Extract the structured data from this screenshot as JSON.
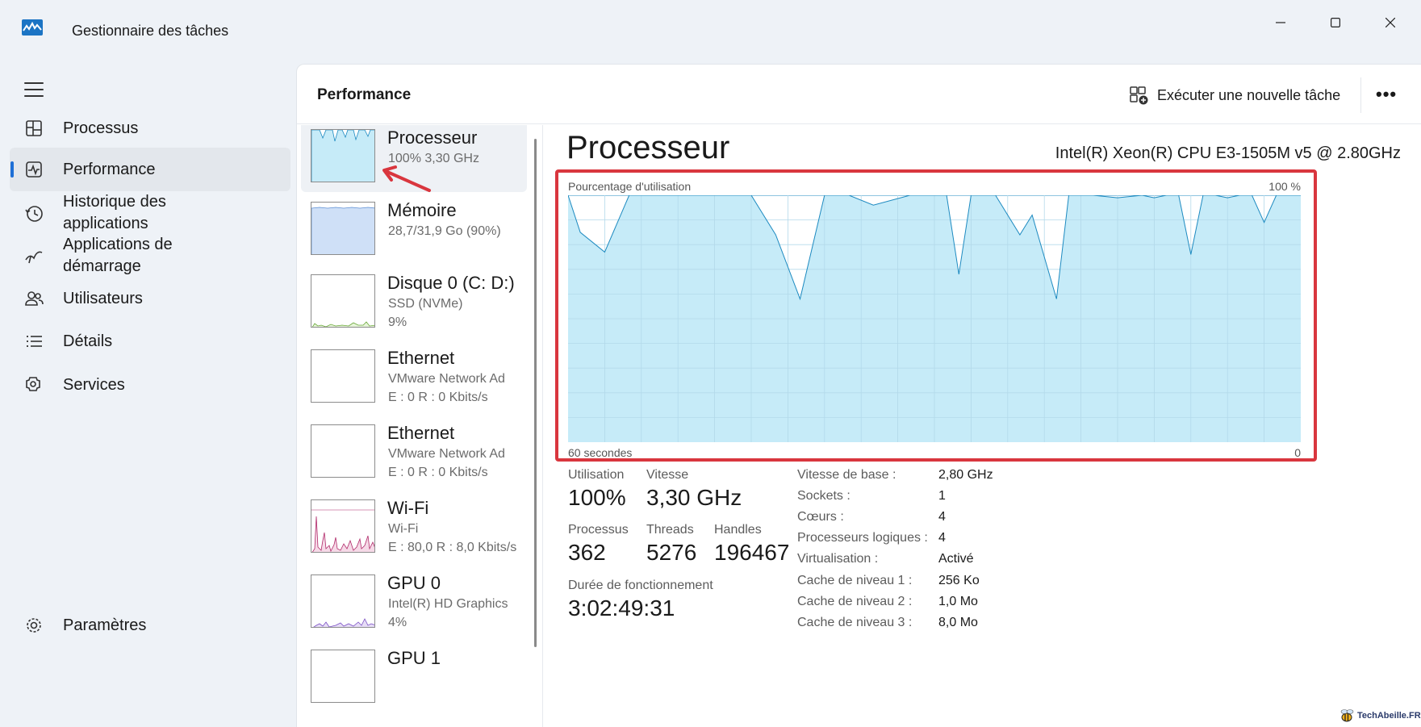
{
  "window": {
    "title": "Gestionnaire des tâches",
    "controls": [
      "minimize",
      "maximize",
      "close"
    ]
  },
  "nav": {
    "items": [
      {
        "label": "Processus",
        "icon": "processes-icon",
        "active": false
      },
      {
        "label": "Performance",
        "icon": "performance-icon",
        "active": true
      },
      {
        "label": "Historique des applications",
        "icon": "history-icon",
        "active": false
      },
      {
        "label": "Applications de démarrage",
        "icon": "startup-icon",
        "active": false
      },
      {
        "label": "Utilisateurs",
        "icon": "users-icon",
        "active": false
      },
      {
        "label": "Détails",
        "icon": "details-icon",
        "active": false
      },
      {
        "label": "Services",
        "icon": "services-icon",
        "active": false
      }
    ],
    "settings_label": "Paramètres"
  },
  "header": {
    "title": "Performance",
    "run_task_label": "Exécuter une nouvelle tâche",
    "more_label": "•••"
  },
  "resources": [
    {
      "name": "Processeur",
      "line1": "100%  3,30 GHz",
      "line2": "",
      "active": true
    },
    {
      "name": "Mémoire",
      "line1": "28,7/31,9 Go (90%)",
      "line2": "",
      "active": false
    },
    {
      "name": "Disque 0 (C: D:)",
      "line1": "SSD (NVMe)",
      "line2": "9%",
      "active": false
    },
    {
      "name": "Ethernet",
      "line1": "VMware Network Ad",
      "line2": "E : 0  R : 0 Kbits/s",
      "active": false
    },
    {
      "name": "Ethernet",
      "line1": "VMware Network Ad",
      "line2": "E : 0  R : 0 Kbits/s",
      "active": false
    },
    {
      "name": "Wi-Fi",
      "line1": "Wi-Fi",
      "line2": "E : 80,0  R : 8,0 Kbits/s",
      "active": false
    },
    {
      "name": "GPU 0",
      "line1": "Intel(R) HD Graphics",
      "line2": "4%",
      "active": false
    },
    {
      "name": "GPU 1",
      "line1": "",
      "line2": "",
      "active": false
    }
  ],
  "detail": {
    "title": "Processeur",
    "model": "Intel(R) Xeon(R) CPU E3-1505M v5 @ 2.80GHz",
    "graph": {
      "top_label": "Pourcentage d'utilisation",
      "top_right": "100 %",
      "bottom_label": "60 secondes",
      "bottom_right": "0",
      "fill_color": "#c6ebf8",
      "line_color": "#1d8ac0"
    },
    "stats": {
      "utilisation_label": "Utilisation",
      "utilisation_value": "100%",
      "vitesse_label": "Vitesse",
      "vitesse_value": "3,30 GHz",
      "processus_label": "Processus",
      "processus_value": "362",
      "threads_label": "Threads",
      "threads_value": "5276",
      "handles_label": "Handles",
      "handles_value": "196467",
      "uptime_label": "Durée de fonctionnement",
      "uptime_value": "3:02:49:31"
    },
    "specs": [
      {
        "key": "Vitesse de base :",
        "value": "2,80 GHz"
      },
      {
        "key": "Sockets :",
        "value": "1"
      },
      {
        "key": "Cœurs :",
        "value": "4"
      },
      {
        "key": "Processeurs logiques :",
        "value": "4"
      },
      {
        "key": "Virtualisation :",
        "value": "Activé"
      },
      {
        "key": "Cache de niveau 1 :",
        "value": "256 Ko"
      },
      {
        "key": "Cache de niveau 2 :",
        "value": "1,0 Mo"
      },
      {
        "key": "Cache de niveau 3 :",
        "value": "8,0 Mo"
      }
    ]
  },
  "chart_data": {
    "type": "area",
    "title": "Pourcentage d'utilisation",
    "xlabel": "60 secondes",
    "ylim": [
      0,
      100
    ],
    "x": [
      60,
      59,
      57,
      55,
      52,
      47,
      45,
      43,
      41,
      39,
      37,
      35,
      32,
      29,
      28,
      27,
      25,
      23,
      22,
      20,
      19,
      17,
      15,
      13,
      12,
      11,
      10,
      9,
      8,
      7,
      6,
      5,
      4,
      3,
      2,
      1,
      0
    ],
    "values": [
      100,
      85,
      77,
      100,
      100,
      100,
      100,
      84,
      58,
      100,
      100,
      96,
      100,
      100,
      68,
      100,
      100,
      84,
      92,
      58,
      100,
      100,
      99,
      100,
      99,
      100,
      100,
      76,
      100,
      100,
      99,
      100,
      100,
      89,
      100,
      100,
      100
    ]
  },
  "watermark": "TechAbeille.FR"
}
